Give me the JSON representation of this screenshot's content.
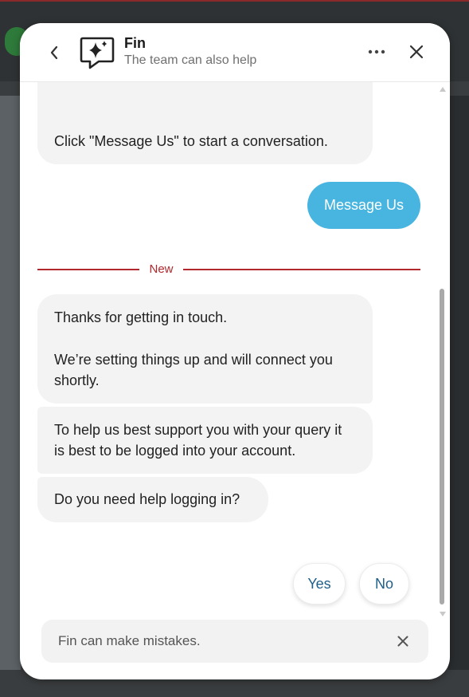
{
  "header": {
    "title": "Fin",
    "subtitle": "The team can also help"
  },
  "messages": {
    "top_bubble_text": "Click \"Message Us\" to start a conversation.",
    "user_message": "Message Us",
    "divider_label": "New",
    "bot_1_line_1": "Thanks for getting in touch.",
    "bot_1_line_2": "We’re setting things up and will connect you shortly.",
    "bot_2": "To help us best support you with your query it is best to be logged into your account.",
    "bot_3": "Do you need help logging in?"
  },
  "quick_replies": {
    "yes": "Yes",
    "no": "No"
  },
  "notice": {
    "text": "Fin can make mistakes."
  },
  "colors": {
    "accent_blue": "#48b4e0",
    "divider_red": "#b2282e",
    "reply_text": "#1f5f8b"
  },
  "icons": {
    "back": "chevron-left-icon",
    "logo": "sparkle-chat-icon",
    "more": "more-horizontal-icon",
    "close": "close-icon"
  }
}
